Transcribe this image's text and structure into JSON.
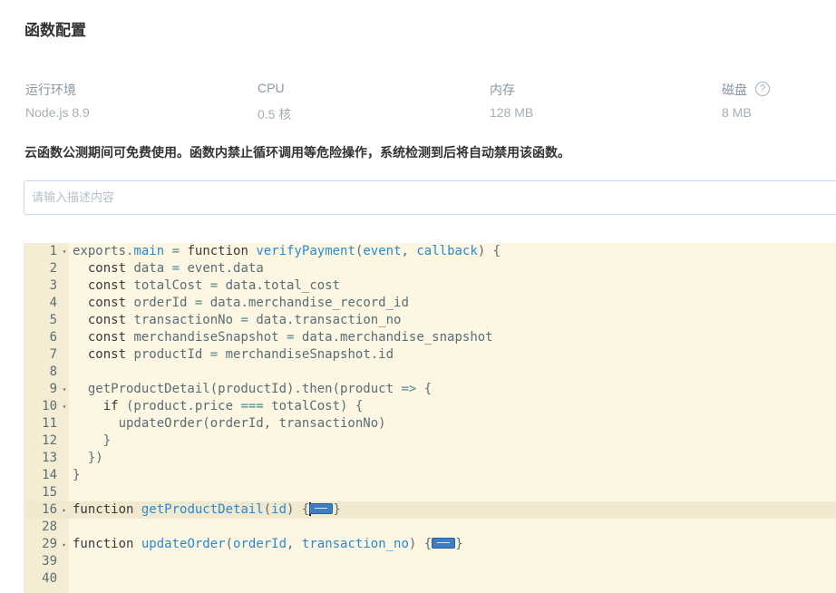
{
  "page": {
    "title": "函数配置"
  },
  "specs": [
    {
      "label": "运行环境",
      "value": "Node.js 8.9"
    },
    {
      "label": "CPU",
      "value": "0.5 核"
    },
    {
      "label": "内存",
      "value": "128 MB"
    },
    {
      "label": "磁盘",
      "value": "8 MB"
    }
  ],
  "help_icon": {
    "glyph": "?"
  },
  "notice": "云函数公测期间可免费使用。函数内禁止循环调用等危险操作，系统检测到后将自动禁用该函数。",
  "description_input": {
    "placeholder": "请输入描述内容",
    "value": ""
  },
  "editor": {
    "lines": [
      {
        "n": "1",
        "fold": "open",
        "code": "exports.main = function verifyPayment(event, callback) {"
      },
      {
        "n": "2",
        "code": "  const data = event.data"
      },
      {
        "n": "3",
        "code": "  const totalCost = data.total_cost"
      },
      {
        "n": "4",
        "code": "  const orderId = data.merchandise_record_id"
      },
      {
        "n": "5",
        "code": "  const transactionNo = data.transaction_no"
      },
      {
        "n": "6",
        "code": "  const merchandiseSnapshot = data.merchandise_snapshot"
      },
      {
        "n": "7",
        "code": "  const productId = merchandiseSnapshot.id"
      },
      {
        "n": "8",
        "code": ""
      },
      {
        "n": "9",
        "fold": "open",
        "code": "  getProductDetail(productId).then(product => {"
      },
      {
        "n": "10",
        "fold": "open",
        "code": "    if (product.price === totalCost) {"
      },
      {
        "n": "11",
        "code": "      updateOrder(orderId, transactionNo)"
      },
      {
        "n": "12",
        "code": "    }"
      },
      {
        "n": "13",
        "code": "  })"
      },
      {
        "n": "14",
        "code": "}"
      },
      {
        "n": "15",
        "code": ""
      },
      {
        "n": "16",
        "fold": "closed",
        "code": "function getProductDetail(id) {",
        "collapsed": true,
        "active": true
      },
      {
        "n": "28",
        "code": ""
      },
      {
        "n": "29",
        "fold": "closed",
        "code": "function updateOrder(orderId, transaction_no) {",
        "collapsed": true
      },
      {
        "n": "39",
        "code": ""
      },
      {
        "n": "40",
        "code": ""
      }
    ]
  }
}
